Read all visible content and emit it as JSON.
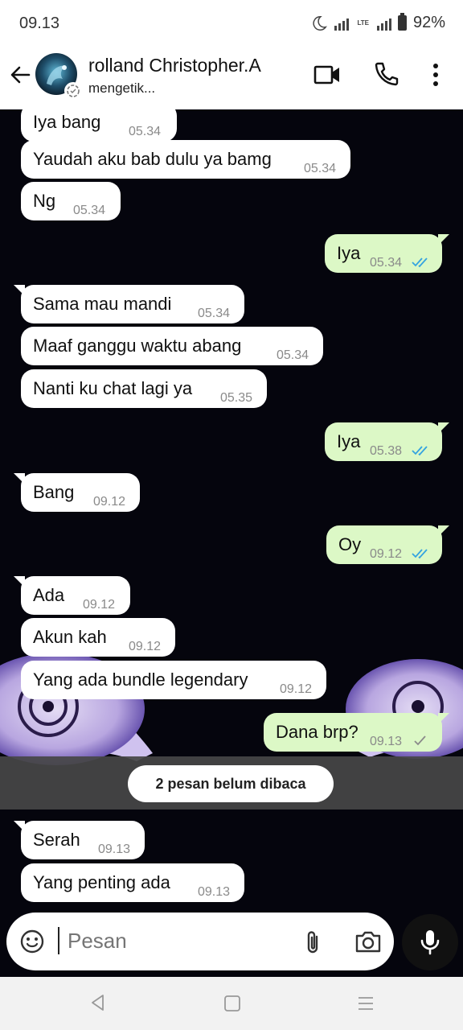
{
  "status_bar": {
    "time": "09.13",
    "battery": "92%",
    "network": "LTE"
  },
  "header": {
    "contact_name": "rolland Christopher.A",
    "status": "mengetik..."
  },
  "messages": [
    {
      "text": "Iya bang",
      "time": "05.34",
      "dir": "in"
    },
    {
      "text": "Yaudah aku bab dulu ya bamg",
      "time": "05.34",
      "dir": "in"
    },
    {
      "text": "Ng",
      "time": "05.34",
      "dir": "in"
    },
    {
      "text": "Iya",
      "time": "05.34",
      "dir": "out",
      "read": true
    },
    {
      "text": "Sama mau mandi",
      "time": "05.34",
      "dir": "in"
    },
    {
      "text": "Maaf ganggu waktu abang",
      "time": "05.34",
      "dir": "in"
    },
    {
      "text": "Nanti ku chat lagi ya",
      "time": "05.35",
      "dir": "in"
    },
    {
      "text": "Iya",
      "time": "05.38",
      "dir": "out",
      "read": true
    },
    {
      "text": "Bang",
      "time": "09.12",
      "dir": "in"
    },
    {
      "text": "Oy",
      "time": "09.12",
      "dir": "out",
      "read": true
    },
    {
      "text": "Ada",
      "time": "09.12",
      "dir": "in"
    },
    {
      "text": "Akun kah",
      "time": "09.12",
      "dir": "in"
    },
    {
      "text": "Yang ada bundle legendary",
      "time": "09.12",
      "dir": "in"
    },
    {
      "text": "Dana brp?",
      "time": "09.13",
      "dir": "out",
      "read": false
    },
    {
      "text": "Serah",
      "time": "09.13",
      "dir": "in"
    },
    {
      "text": "Yang penting ada",
      "time": "09.13",
      "dir": "in"
    }
  ],
  "unread_banner": "2 pesan belum dibaca",
  "input": {
    "placeholder": "Pesan",
    "value": ""
  },
  "icons": {
    "back": "arrow-left-icon",
    "video": "video-call-icon",
    "call": "phone-icon",
    "menu": "more-vertical-icon",
    "emoji": "emoji-icon",
    "attach": "paperclip-icon",
    "camera": "camera-icon",
    "mic": "microphone-icon"
  },
  "colors": {
    "incoming": "#ffffff",
    "outgoing": "#dcf8c6",
    "read_tick": "#34a3e0",
    "sent_tick": "#8a8a8a"
  }
}
